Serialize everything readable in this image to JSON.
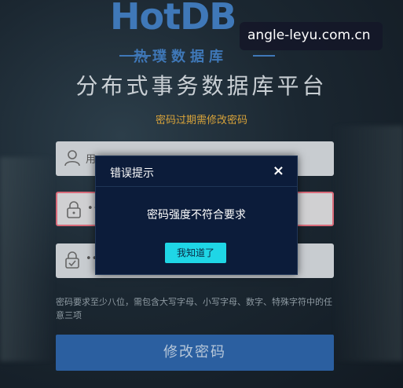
{
  "logo": {
    "text": "HotDB",
    "subtitle": "热璞数据库"
  },
  "watermark": "angle-leyu.com.cn",
  "header": {
    "title": "分布式事务数据库平台",
    "subtitle": "密码过期需修改密码"
  },
  "form": {
    "username_placeholder": "用",
    "password_value": "••••",
    "confirm_value": "••••",
    "hint": "密码要求至少八位，需包含大写字母、小写字母、数字、特殊字符中的任意三项",
    "submit_label": "修改密码"
  },
  "dialog": {
    "title": "错误提示",
    "close": "×",
    "message": "密码强度不符合要求",
    "ok_label": "我知道了"
  },
  "colors": {
    "accent": "#1fd6e6",
    "primary_button": "#2b5fa0",
    "warning_text": "#d8a33a",
    "error_border": "#d96b7a",
    "dialog_bg": "#0c1c3a"
  }
}
